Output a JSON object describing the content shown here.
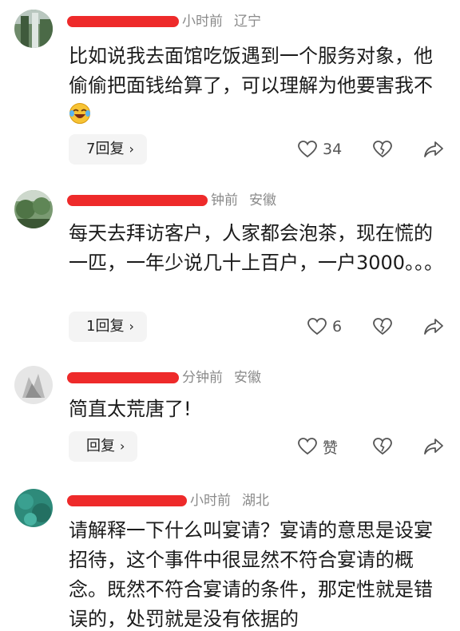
{
  "comments": [
    {
      "time": "小时前",
      "location": "辽宁",
      "text": "比如说我去面馆吃饭遇到一个服务对象，他偷偷把面钱给算了，可以理解为他要害我不",
      "emoji": "crying-laughing-emoji",
      "reply_label": "7回复",
      "like_count": "34"
    },
    {
      "time": "钟前",
      "location": "安徽",
      "text": "每天去拜访客户，人家都会泡茶，现在慌的一匹，一年少说几十上百户，一户3000。。。",
      "reply_label": "1回复",
      "like_count": "6"
    },
    {
      "time": "分钟前",
      "location": "安徽",
      "text": "简直太荒唐了!",
      "reply_label": "回复",
      "like_count": "赞"
    },
    {
      "time": "小时前",
      "location": "湖北",
      "text": "请解释一下什么叫宴请？宴请的意思是设宴招待，这个事件中很显然不符合宴请的概念。既然不符合宴请的条件，那定性就是错误的，处罚就是没有依据的"
    }
  ],
  "colors": {
    "redaction": "#ee2a2a",
    "meta": "#8a8a8a",
    "pill_bg": "#f4f4f4"
  },
  "icons": [
    "heart-outline-icon",
    "broken-heart-icon",
    "share-arrow-icon",
    "chevron-right-icon"
  ]
}
